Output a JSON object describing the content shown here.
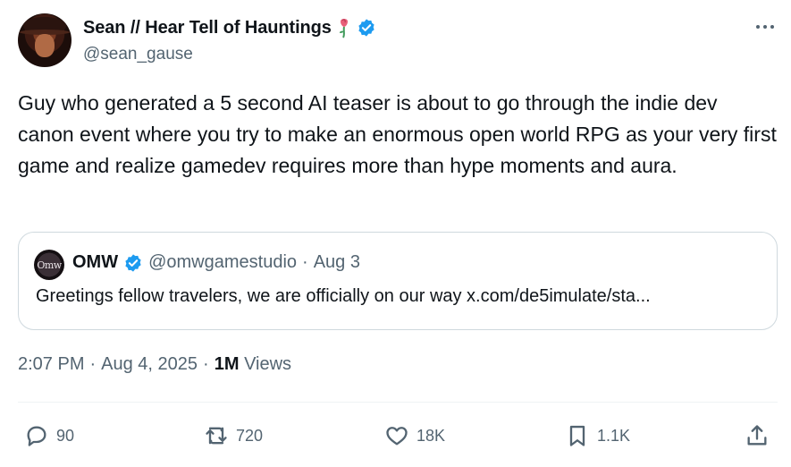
{
  "author": {
    "display_name": "Sean // Hear Tell of Hauntings",
    "handle": "@sean_gause"
  },
  "tweet": {
    "text": "Guy who generated a 5 second AI teaser is about to go through the indie dev canon event where you try to make an enormous open world RPG as your very first game and realize gamedev requires more than hype moments and aura.",
    "time": "2:07 PM",
    "separator": "·",
    "date": "Aug 4, 2025",
    "views_count": "1M",
    "views_label": "Views"
  },
  "quote": {
    "avatar_text": "Omw",
    "name": "OMW",
    "handle": "@omwgamestudio",
    "separator": "·",
    "date": "Aug 3",
    "text": "Greetings fellow travelers, we are officially on our way x.com/de5imulate/sta..."
  },
  "actions": {
    "replies": "90",
    "reposts": "720",
    "likes": "18K",
    "bookmarks": "1.1K"
  },
  "colors": {
    "verified": "#1d9bf0",
    "secondary_text": "#536471",
    "border": "#cfd9de"
  },
  "icons": [
    "rose-icon",
    "verified-icon",
    "more-icon",
    "reply-icon",
    "repost-icon",
    "like-icon",
    "bookmark-icon",
    "share-icon"
  ]
}
